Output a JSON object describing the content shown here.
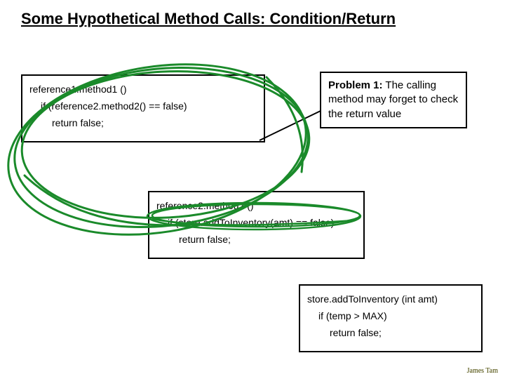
{
  "title": "Some Hypothetical Method Calls: Condition/Return",
  "box1": {
    "signature": "reference1.method1 ()",
    "line1": "if (reference2.method2() == false)",
    "line2": "return false;"
  },
  "box2": {
    "signature": "reference2.method2 ()",
    "line1": "if (store.addToInventory(amt) == false)",
    "line2": "return false;"
  },
  "box3": {
    "signature": "store.addToInventory (int amt)",
    "line1": "if (temp > MAX)",
    "line2": "return false;"
  },
  "problem": {
    "label": "Problem 1:",
    "text": "  The calling method may forget to check the return value"
  },
  "footer": "James Tam"
}
